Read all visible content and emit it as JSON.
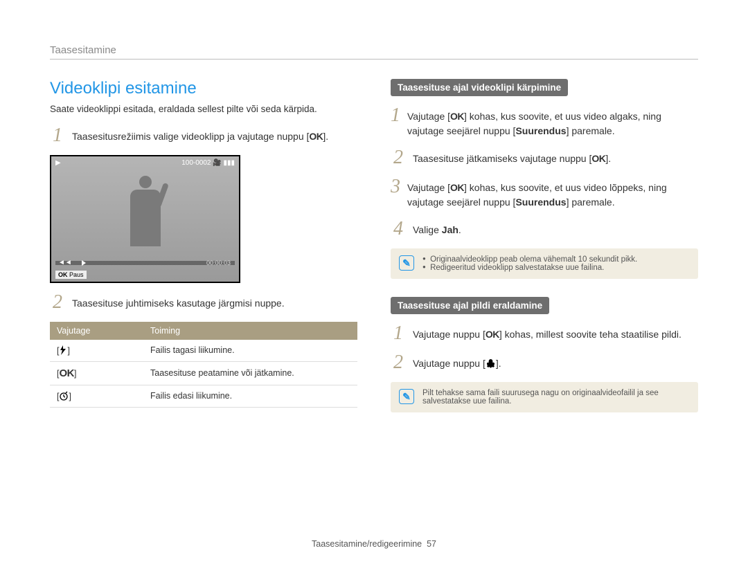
{
  "breadcrumb": "Taasesitamine",
  "left": {
    "heading": "Videoklipi esitamine",
    "intro": "Saate videoklippi esitada, eraldada sellest pilte või seda kärpida.",
    "step1": "Taasesitusrežiimis valige videoklipp ja vajutage nuppu [",
    "step1_end": "].",
    "screen": {
      "top_right": "100-0002",
      "time": "00:00:03",
      "bottom": "Paus",
      "bottom_prefix": "OK"
    },
    "step2": "Taasesituse juhtimiseks kasutage järgmisi nuppe.",
    "table": {
      "h1": "Vajutage",
      "h2": "Toiming",
      "rows": [
        {
          "icon": "flash",
          "desc": "Failis tagasi liikumine."
        },
        {
          "icon": "ok",
          "desc": "Taasesituse peatamine või jätkamine."
        },
        {
          "icon": "timer",
          "desc": "Failis edasi liikumine."
        }
      ]
    }
  },
  "right": {
    "hdr1": "Taasesituse ajal videoklipi kärpimine",
    "s1a": "Vajutage [",
    "s1b": "] kohas, kus soovite, et uus video algaks, ning vajutage seejärel nuppu [",
    "s1c": "] paremale.",
    "s1_bold": "Suurendus",
    "s2a": "Taasesituse jätkamiseks vajutage nuppu [",
    "s2b": "].",
    "s3a": "Vajutage [",
    "s3b": "] kohas, kus soovite, et uus video lõppeks, ning vajutage seejärel nuppu [",
    "s3c": "] paremale.",
    "s4a": "Valige ",
    "s4_bold": "Jah",
    "s4b": ".",
    "note1a": "Originaalvideoklipp peab olema vähemalt 10 sekundit pikk.",
    "note1b": "Redigeeritud videoklipp salvestatakse uue failina.",
    "hdr2": "Taasesituse ajal pildi eraldamine",
    "p1a": "Vajutage nuppu [",
    "p1b": "] kohas, millest soovite teha staatilise pildi.",
    "p2a": "Vajutage nuppu [",
    "p2b": "].",
    "note2": "Pilt tehakse sama faili suurusega nagu on originaalvideofailil ja see salvestatakse uue failina."
  },
  "footer": {
    "text": "Taasesitamine/redigeerimine",
    "page": "57"
  }
}
